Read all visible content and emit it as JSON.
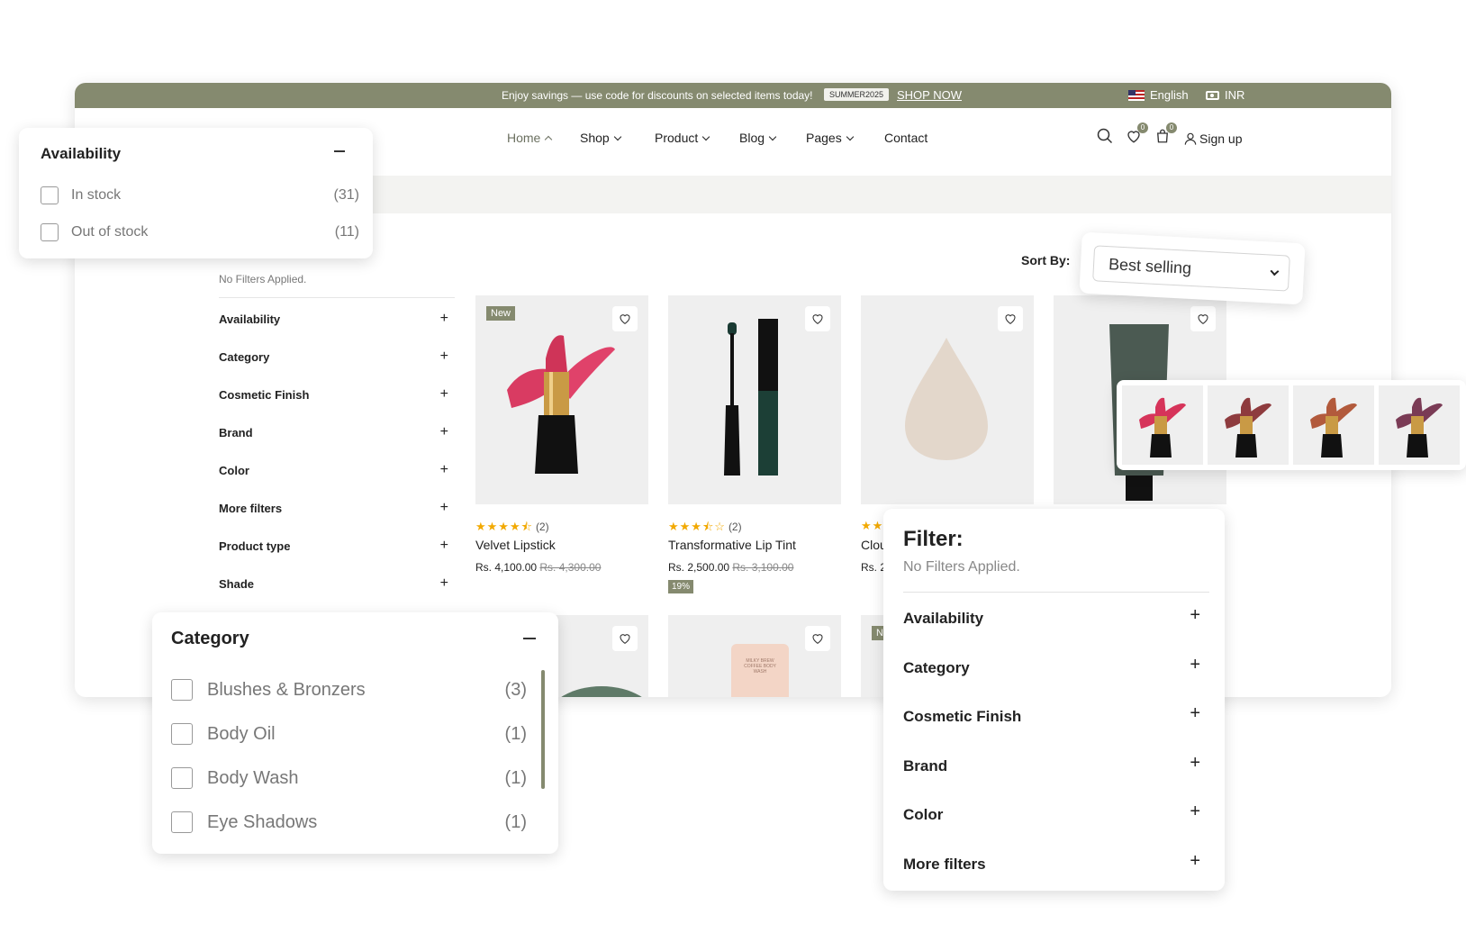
{
  "topbar": {
    "promo": "Enjoy savings — use code for discounts on selected items today!",
    "code": "SUMMER2025",
    "shop_now": "SHOP NOW",
    "language": "English",
    "currency": "INR",
    "bg_color": "#858a6f"
  },
  "nav": {
    "items": [
      "Home",
      "Shop",
      "Product",
      "Blog",
      "Pages",
      "Contact"
    ],
    "wishlist_count": "0",
    "cart_count": "0",
    "signup": "Sign up"
  },
  "sidebar": {
    "title": "Filter:",
    "no_filters": "No Filters Applied.",
    "groups": [
      "Availability",
      "Category",
      "Cosmetic Finish",
      "Brand",
      "Color",
      "More filters",
      "Product type",
      "Shade"
    ]
  },
  "sort": {
    "label": "Sort By:",
    "value": "Best selling"
  },
  "products": [
    {
      "name": "Velvet Lipstick",
      "tag": "New",
      "rating": "★★★★⯪",
      "reviews": "(2)",
      "price": "Rs. 4,100.00",
      "compare": "Rs. 4,300.00"
    },
    {
      "name": "Transformative Lip Tint",
      "rating": "★★★⯪☆",
      "reviews": "(2)",
      "price": "Rs. 2,500.00",
      "compare": "Rs. 3,100.00",
      "discount": "19%"
    },
    {
      "name": "Clou",
      "rating": "★★",
      "price": "Rs. 2"
    },
    {
      "name": ""
    }
  ],
  "row2": {
    "tag": "Ne",
    "tube_text": "MILKY BREW COFFEE BODY WASH"
  },
  "availability_panel": {
    "title": "Availability",
    "options": [
      {
        "label": "In stock",
        "count": "(31)"
      },
      {
        "label": "Out of stock",
        "count": "(11)"
      }
    ]
  },
  "category_panel": {
    "title": "Category",
    "options": [
      {
        "label": "Blushes & Bronzers",
        "count": "(3)"
      },
      {
        "label": "Body Oil",
        "count": "(1)"
      },
      {
        "label": "Body Wash",
        "count": "(1)"
      },
      {
        "label": "Eye Shadows",
        "count": "(1)"
      }
    ]
  },
  "filter_panel": {
    "title": "Filter:",
    "no_filters": "No Filters Applied.",
    "groups": [
      "Availability",
      "Category",
      "Cosmetic Finish",
      "Brand",
      "Color",
      "More filters"
    ]
  },
  "swatches": {
    "colors": [
      "#d6345a",
      "#8e3b3e",
      "#b25a3c",
      "#7a3b55"
    ]
  }
}
